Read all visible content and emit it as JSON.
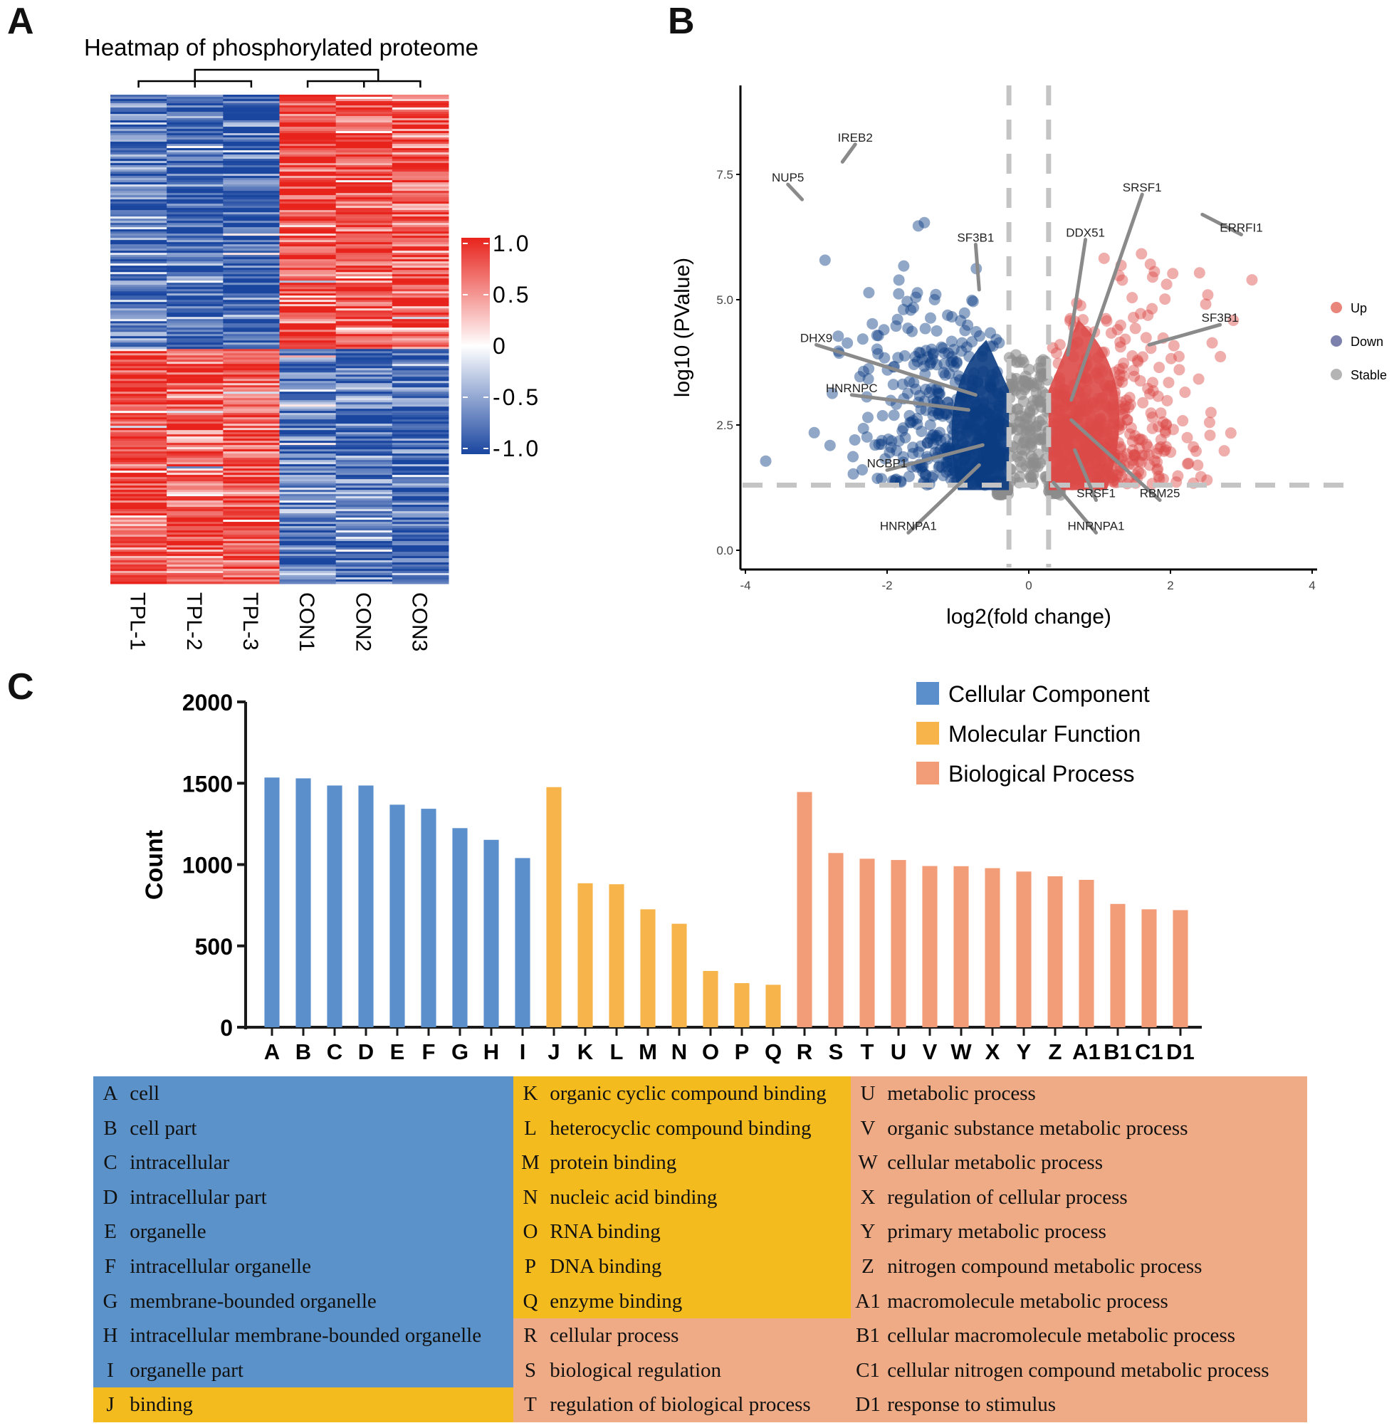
{
  "panels": {
    "a": "A",
    "b": "B",
    "c": "C"
  },
  "chart_data": [
    {
      "type": "heatmap",
      "title": "Heatmap of phosphorylated proteome",
      "columns": [
        "TPL-1",
        "TPL-2",
        "TPL-3",
        "CON1",
        "CON2",
        "CON3"
      ],
      "row_clusters": [
        {
          "name": "cluster-1",
          "fraction": 0.52,
          "pattern": [
            -0.7,
            -0.85,
            -0.85,
            0.85,
            0.75,
            0.7
          ]
        },
        {
          "name": "cluster-2",
          "fraction": 0.48,
          "pattern": [
            0.8,
            0.75,
            0.75,
            -0.75,
            -0.7,
            -0.85
          ]
        }
      ],
      "colorbar": {
        "min": -1.0,
        "max": 1.0,
        "ticks": [
          "1.0",
          "0.5",
          "0",
          "-0.5",
          "-1.0"
        ],
        "colors": {
          "low": "#1a46a0",
          "mid": "#ffffff",
          "high": "#e8231c"
        }
      },
      "dendrogram": "TPL-1,TPL-2,TPL-3 | CON1,CON2,CON3"
    },
    {
      "type": "scatter",
      "title": "",
      "xlabel": "log2(fold change)",
      "ylabel": "log10 (PValue)",
      "xlim": [
        -4.1,
        4.1
      ],
      "ylim": [
        -0.6,
        8.8
      ],
      "xticks": [
        "-4",
        "-2",
        "0",
        "2",
        "4"
      ],
      "yticks": [
        "0.0",
        "2.5",
        "5.0",
        "7.5"
      ],
      "thresholds": {
        "log2fc": [
          -0.28,
          0.28
        ],
        "log10p": 1.3
      },
      "legend": {
        "position": "right",
        "entries": [
          {
            "label": "Up",
            "color": "#e8867c"
          },
          {
            "label": "Down",
            "color": "#7c80ad"
          },
          {
            "label": "Stable",
            "color": "#b4b4b4"
          }
        ]
      },
      "colors": {
        "up": "#dc4a48",
        "down": "#0b3c82",
        "stable": "#8c8c8c"
      },
      "labeled_points": [
        {
          "label": "IREB2",
          "x": -2.63,
          "y": 7.75,
          "lx": -2.45,
          "ly": 8.1
        },
        {
          "label": "NUP5",
          "x": -3.2,
          "y": 7.0,
          "lx": -3.4,
          "ly": 7.3
        },
        {
          "label": "SF3B1",
          "x": -0.7,
          "y": 5.2,
          "lx": -0.75,
          "ly": 6.1
        },
        {
          "label": "DHX9",
          "x": -0.75,
          "y": 3.1,
          "lx": -3.0,
          "ly": 4.1
        },
        {
          "label": "HNRNPC",
          "x": -0.85,
          "y": 2.8,
          "lx": -2.5,
          "ly": 3.1
        },
        {
          "label": "NCBP1",
          "x": -0.65,
          "y": 2.1,
          "lx": -2.0,
          "ly": 1.6
        },
        {
          "label": "HNRNPA1",
          "x": -0.7,
          "y": 1.7,
          "lx": -1.7,
          "ly": 0.35
        },
        {
          "label": "SRSF1",
          "x": 0.6,
          "y": 3.0,
          "lx": 1.6,
          "ly": 7.1
        },
        {
          "label": "DDX51",
          "x": 0.55,
          "y": 3.9,
          "lx": 0.8,
          "ly": 6.2
        },
        {
          "label": "ERRFI1",
          "x": 2.45,
          "y": 6.7,
          "lx": 3.0,
          "ly": 6.3
        },
        {
          "label": "SF3B1",
          "x": 1.7,
          "y": 4.1,
          "lx": 2.7,
          "ly": 4.5
        },
        {
          "label": "SRSF1",
          "x": 0.65,
          "y": 2.0,
          "lx": 0.95,
          "ly": 1.0
        },
        {
          "label": "RBM25",
          "x": 0.6,
          "y": 2.6,
          "lx": 1.85,
          "ly": 1.0
        },
        {
          "label": "HNRNPA1",
          "x": 0.35,
          "y": 1.35,
          "lx": 0.95,
          "ly": 0.35
        }
      ]
    },
    {
      "type": "bar",
      "title": "",
      "xlabel": "",
      "ylabel": "Count",
      "ylim": [
        0,
        2000
      ],
      "yticks": [
        "0",
        "500",
        "1000",
        "1500",
        "2000"
      ],
      "legend": {
        "position": "top-right",
        "entries": [
          {
            "label": "Cellular Component",
            "color": "#5b8fcb"
          },
          {
            "label": "Molecular Function",
            "color": "#f6b44a"
          },
          {
            "label": "Biological Process",
            "color": "#f29c78"
          }
        ]
      },
      "categories": [
        "A",
        "B",
        "C",
        "D",
        "E",
        "F",
        "G",
        "H",
        "I",
        "J",
        "K",
        "L",
        "M",
        "N",
        "O",
        "P",
        "Q",
        "R",
        "S",
        "T",
        "U",
        "V",
        "W",
        "X",
        "Y",
        "Z",
        "A1",
        "B1",
        "C1",
        "D1"
      ],
      "values": [
        1535,
        1530,
        1486,
        1486,
        1368,
        1343,
        1224,
        1152,
        1040,
        1476,
        885,
        879,
        725,
        636,
        346,
        271,
        261,
        1446,
        1071,
        1036,
        1028,
        991,
        990,
        978,
        957,
        928,
        906,
        758,
        725,
        720
      ],
      "groups": [
        "Cellular Component",
        "Cellular Component",
        "Cellular Component",
        "Cellular Component",
        "Cellular Component",
        "Cellular Component",
        "Cellular Component",
        "Cellular Component",
        "Cellular Component",
        "Molecular Function",
        "Molecular Function",
        "Molecular Function",
        "Molecular Function",
        "Molecular Function",
        "Molecular Function",
        "Molecular Function",
        "Molecular Function",
        "Biological Process",
        "Biological Process",
        "Biological Process",
        "Biological Process",
        "Biological Process",
        "Biological Process",
        "Biological Process",
        "Biological Process",
        "Biological Process",
        "Biological Process",
        "Biological Process",
        "Biological Process",
        "Biological Process"
      ]
    }
  ],
  "go_table": {
    "colors": {
      "cc": "#5b92c9",
      "mf": "#f3bb1e",
      "bp": "#eeab85"
    },
    "columns": [
      [
        {
          "code": "A",
          "term": "cell",
          "group": "cc"
        },
        {
          "code": "B",
          "term": "cell part",
          "group": "cc"
        },
        {
          "code": "C",
          "term": "intracellular",
          "group": "cc"
        },
        {
          "code": "D",
          "term": "intracellular part",
          "group": "cc"
        },
        {
          "code": "E",
          "term": "organelle",
          "group": "cc"
        },
        {
          "code": "F",
          "term": "intracellular organelle",
          "group": "cc"
        },
        {
          "code": "G",
          "term": "membrane-bounded organelle",
          "group": "cc"
        },
        {
          "code": "H",
          "term": "intracellular membrane-bounded organelle",
          "group": "cc"
        },
        {
          "code": "I",
          "term": "organelle part",
          "group": "cc"
        },
        {
          "code": "J",
          "term": "binding",
          "group": "mf"
        }
      ],
      [
        {
          "code": "K",
          "term": "organic cyclic compound binding",
          "group": "mf"
        },
        {
          "code": "L",
          "term": "heterocyclic compound binding",
          "group": "mf"
        },
        {
          "code": "M",
          "term": "protein binding",
          "group": "mf"
        },
        {
          "code": "N",
          "term": "nucleic acid binding",
          "group": "mf"
        },
        {
          "code": "O",
          "term": "RNA binding",
          "group": "mf"
        },
        {
          "code": "P",
          "term": "DNA binding",
          "group": "mf"
        },
        {
          "code": "Q",
          "term": "enzyme binding",
          "group": "mf"
        },
        {
          "code": "R",
          "term": "cellular process",
          "group": "bp"
        },
        {
          "code": "S",
          "term": "biological regulation",
          "group": "bp"
        },
        {
          "code": "T",
          "term": "regulation of biological process",
          "group": "bp"
        }
      ],
      [
        {
          "code": "U",
          "term": "metabolic process",
          "group": "bp"
        },
        {
          "code": "V",
          "term": "organic substance metabolic process",
          "group": "bp"
        },
        {
          "code": "W",
          "term": "cellular metabolic process",
          "group": "bp"
        },
        {
          "code": "X",
          "term": "regulation of cellular process",
          "group": "bp"
        },
        {
          "code": "Y",
          "term": "primary metabolic process",
          "group": "bp"
        },
        {
          "code": "Z",
          "term": "nitrogen compound metabolic process",
          "group": "bp"
        },
        {
          "code": "A1",
          "term": "macromolecule metabolic process",
          "group": "bp"
        },
        {
          "code": "B1",
          "term": "cellular macromolecule metabolic process",
          "group": "bp"
        },
        {
          "code": "C1",
          "term": "cellular nitrogen compound metabolic process",
          "group": "bp"
        },
        {
          "code": "D1",
          "term": "response to stimulus",
          "group": "bp"
        }
      ]
    ]
  }
}
